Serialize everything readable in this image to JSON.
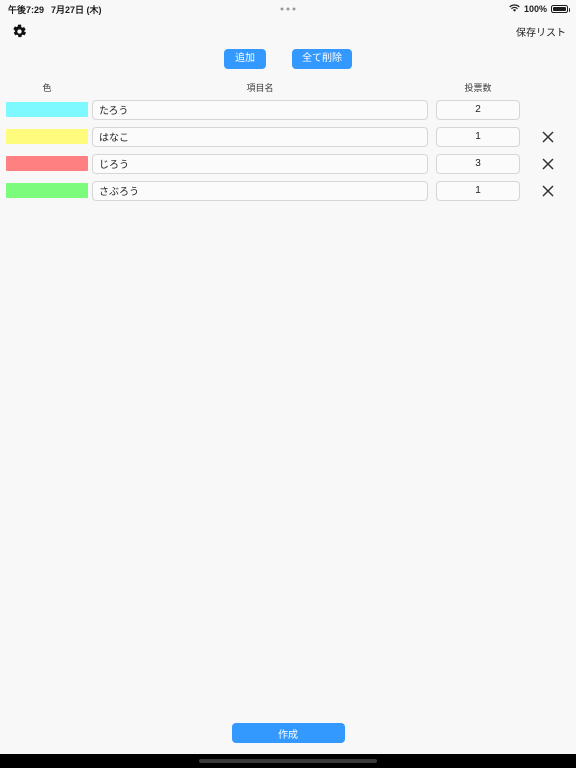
{
  "status_bar": {
    "time": "午後7:29",
    "date": "7月27日 (木)",
    "multitask_dots": "···",
    "wifi_icon": "wifi-icon",
    "battery_percent": "100%",
    "battery_icon": "battery-full-icon"
  },
  "nav_bar": {
    "settings_icon": "gear-icon",
    "saved_list_label": "保存リスト"
  },
  "toolbar": {
    "add_label": "追加",
    "clear_all_label": "全て削除"
  },
  "table": {
    "headers": {
      "color": "色",
      "name": "項目名",
      "votes": "投票数"
    },
    "delete_icon": "close-x-icon",
    "rows": [
      {
        "color": "#7DF9FF",
        "name": "たろう",
        "votes": "2",
        "deletable": false
      },
      {
        "color": "#FFFB7D",
        "name": "はなこ",
        "votes": "1",
        "deletable": true
      },
      {
        "color": "#FF8080",
        "name": "じろう",
        "votes": "3",
        "deletable": true
      },
      {
        "color": "#7DFB7D",
        "name": "さぶろう",
        "votes": "1",
        "deletable": true
      }
    ]
  },
  "footer": {
    "create_label": "作成"
  },
  "colors": {
    "accent_blue": "#3399FF",
    "page_background": "#F8F8F8",
    "input_border": "#D6D6D6"
  }
}
